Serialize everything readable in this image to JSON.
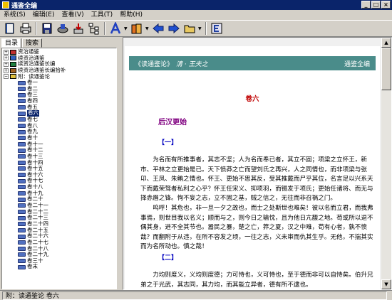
{
  "window": {
    "title": "通鉴全编"
  },
  "menu": [
    "系统(S)",
    "编辑(E)",
    "查看(V)",
    "工具(T)",
    "帮助(H)"
  ],
  "tabs": [
    "目录",
    "搜索"
  ],
  "tree": {
    "top": [
      "资治通鉴",
      "续资治通鉴",
      "续资治通鉴长编",
      "续资治通鉴长编拾补",
      "附：读通鉴论"
    ],
    "volumes": [
      "卷一",
      "卷二",
      "卷三",
      "卷四",
      "卷五",
      "卷六",
      "卷七",
      "卷八",
      "卷九",
      "卷十",
      "卷十一",
      "卷十二",
      "卷十三",
      "卷十四",
      "卷十五",
      "卷十六",
      "卷十七",
      "卷十八",
      "卷十九",
      "卷二十",
      "卷二十一",
      "卷二十二",
      "卷二十三",
      "卷二十四",
      "卷二十五",
      "卷二十六",
      "卷二十七",
      "卷二十八",
      "卷二十九",
      "卷三十",
      "卷末"
    ],
    "selected": "卷六"
  },
  "content": {
    "banner_left": "《读通鉴论》",
    "banner_author": "清 · 王夫之",
    "banner_right": "通鉴全编",
    "chapter": "卷六",
    "section": "后汉更始",
    "mark1": "【一】",
    "para1": "为名而有所推事者，其志不坚；人为名而奉已者，其立不固；项梁之立怀王，新市、平林之立更始是已。天下愤莽之亡而望刘氏之再兴，人之同情也，而非项梁与张卬、王凤、朱鲔之情也。怀王、更始不思其反，受其推戴而尸乎其位，名言足以兴系天下而戴荣驽者私利之心乎？怀王任宋义、抑项羽，而锡发于项氏；更始任诸将、而无与择赤眉之锋。恂不妄之志，立不固之基，贼之信之，无往而非召祸之门。",
    "para2": "呜呼！其危也，非一旦一夕之故也，而士之处斯世也难矣！彼以名而立君，而我弗事焉，则世目我以名义；顺而与之，则今日之输忱，且为他日亢馥之地。苟或所以退不偶其身，进不全其节也。嚣民之暴，楚之亡，莽之夏，汉之中难，苟有心者，孰不愤哉？而翻附于从违，在所不容发之顷，一往之志，义未审而仇其生乎。无他，不揣其实而为名所动也。慎之哉！",
    "mark2": "【二】",
    "para3": "力均则度义，义均则度德；力可恃也，义可恃也，至于德而非可以自恃矣。伯升兄弟之于光武，其志同，其力均，而其能立异者，德有所不逮也。"
  },
  "status": "附：读通鉴论 卷六"
}
